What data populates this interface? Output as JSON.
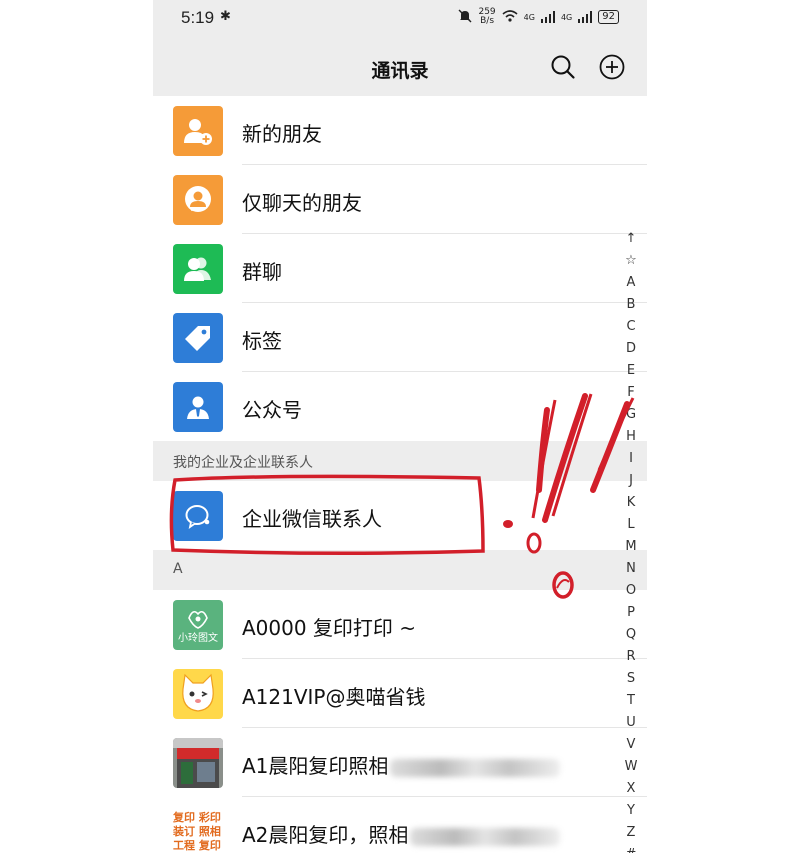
{
  "status_bar": {
    "time": "5:19",
    "speed_value": "259",
    "speed_unit": "B/s",
    "network_1": "4G",
    "network_2": "4G",
    "battery": "92"
  },
  "header": {
    "title": "通讯录"
  },
  "top_items": [
    {
      "label": "新的朋友",
      "icon": "add-friend-icon",
      "color": "#f59b38"
    },
    {
      "label": "仅聊天的朋友",
      "icon": "chat-only-friend-icon",
      "color": "#f59b38"
    },
    {
      "label": "群聊",
      "icon": "group-chat-icon",
      "color": "#1ebb55"
    },
    {
      "label": "标签",
      "icon": "tag-icon",
      "color": "#2e7dd7"
    },
    {
      "label": "公众号",
      "icon": "official-account-icon",
      "color": "#2e7dd7"
    }
  ],
  "section_enterprise": {
    "title": "我的企业及企业联系人",
    "item": {
      "label": "企业微信联系人",
      "icon": "work-wechat-icon",
      "color": "#2e7dd7"
    }
  },
  "section_a": {
    "title": "A",
    "contacts": [
      {
        "label": "A0000 复印打印 ~",
        "avatar": "xiaoling-logo-avatar",
        "avatar_text": "小玲图文"
      },
      {
        "label": "A121VIP@奥喵省钱",
        "avatar": "cat-avatar"
      },
      {
        "label": "A1晨阳复印照相",
        "avatar": "shopfront-avatar"
      },
      {
        "label": "A2晨阳复印，照相",
        "avatar": "print-shop-text-avatar",
        "avatar_lines": [
          "复印 彩印",
          "装订 照相",
          "工程 复印"
        ]
      }
    ]
  },
  "index_letters": [
    "↑",
    "☆",
    "A",
    "B",
    "C",
    "D",
    "E",
    "F",
    "G",
    "H",
    "I",
    "J",
    "K",
    "L",
    "M",
    "N",
    "O",
    "P",
    "Q",
    "R",
    "S",
    "T",
    "U",
    "V",
    "W",
    "X",
    "Y",
    "Z",
    "#"
  ]
}
